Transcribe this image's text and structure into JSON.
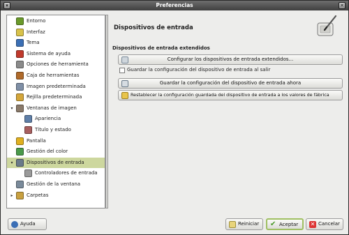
{
  "window": {
    "title": "Preferencias"
  },
  "sidebar": {
    "items": [
      {
        "label": "Entorno",
        "icon": "environment-icon",
        "color": "#6a9a2a"
      },
      {
        "label": "Interfaz",
        "icon": "interface-icon",
        "color": "#d8c24a"
      },
      {
        "label": "Tema",
        "icon": "theme-icon",
        "color": "#3b6fb5"
      },
      {
        "label": "Sistema de ayuda",
        "icon": "help-system-icon",
        "color": "#c0392b"
      },
      {
        "label": "Opciones de herramienta",
        "icon": "tool-options-icon",
        "color": "#8a8a8a"
      },
      {
        "label": "Caja de herramientas",
        "icon": "toolbox-icon",
        "color": "#b06a2a"
      },
      {
        "label": "Imagen predeterminada",
        "icon": "default-image-icon",
        "color": "#7f8fa6"
      },
      {
        "label": "Rejilla predeterminada",
        "icon": "default-grid-icon",
        "color": "#d4a63a"
      },
      {
        "label": "Ventanas de imagen",
        "icon": "image-windows-icon",
        "color": "#8a7a6a"
      },
      {
        "label": "Apariencia",
        "icon": "appearance-icon",
        "color": "#5f7fa8"
      },
      {
        "label": "Título y estado",
        "icon": "title-status-icon",
        "color": "#a85f5f"
      },
      {
        "label": "Pantalla",
        "icon": "display-icon",
        "color": "#e0b020"
      },
      {
        "label": "Gestión del color",
        "icon": "color-management-icon",
        "color": "#4a9a4a"
      },
      {
        "label": "Dispositivos de entrada",
        "icon": "input-devices-icon",
        "color": "#6a7a8a"
      },
      {
        "label": "Controladores de entrada",
        "icon": "input-controllers-icon",
        "color": "#9a9a9a"
      },
      {
        "label": "Gestión de la ventana",
        "icon": "window-management-icon",
        "color": "#7a8a9a"
      },
      {
        "label": "Carpetas",
        "icon": "folders-icon",
        "color": "#c8a040"
      }
    ],
    "selected_index": 13,
    "selected_color": "#cdd79e"
  },
  "main": {
    "title": "Dispositivos de entrada",
    "header_icon": "tablet-stylus-icon",
    "section_title": "Dispositivos de entrada extendidos",
    "configure_button": "Configurar los dispositivos de entrada extendidos...",
    "save_on_exit_label": "Guardar la configuración del dispositivo de entrada al salir",
    "save_on_exit_checked": false,
    "save_now_button": "Guardar la configuración del dispositivo de entrada ahora",
    "reset_button": "Restablecer la configuración guardada del dispositivo de entrada a los valores de fábrica"
  },
  "footer": {
    "help_button": "Ayuda",
    "reset_button": "Reiniciar",
    "accept_button": "Aceptar",
    "cancel_button": "Cancelar"
  }
}
